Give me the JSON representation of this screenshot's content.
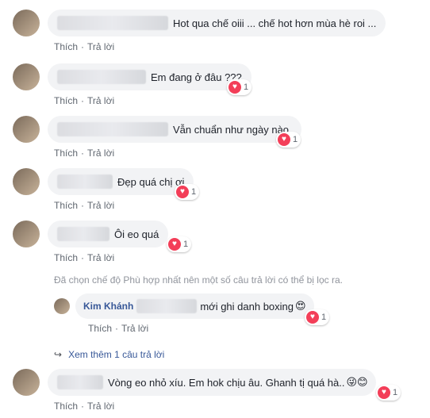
{
  "actions": {
    "like": "Thích",
    "reply": "Trả lời"
  },
  "comments": [
    {
      "text": "Hot qua chế oiii ... chế hot hơn mùa hè roi ...",
      "reactions": ""
    },
    {
      "text": "Em đang ở đâu ???",
      "reactions": "1"
    },
    {
      "text": "Vẫn chuẩn như ngày nào.",
      "reactions": "1"
    },
    {
      "text": "Đẹp quá chị ơi",
      "reactions": "1"
    },
    {
      "text": "Ôi eo quá",
      "reactions": "1"
    },
    {
      "text": "Vòng eo nhỏ xíu. Em hok chịu âu. Ghanh tị quá hà..",
      "reactions": "1"
    }
  ],
  "filter_note": "Đã chọn chế độ Phù hợp nhất nên một số câu trả lời có thể bị lọc ra.",
  "reply": {
    "author": "Kim Khánh",
    "text": "mới ghi danh boxing",
    "emoji": "😍",
    "reactions": "1"
  },
  "view_more": "Xem thêm 1 câu trả lời",
  "last_emoji": "😜😊",
  "colors": {
    "link": "#385898",
    "bubble": "#f2f3f5",
    "heart": "#f33e58"
  }
}
